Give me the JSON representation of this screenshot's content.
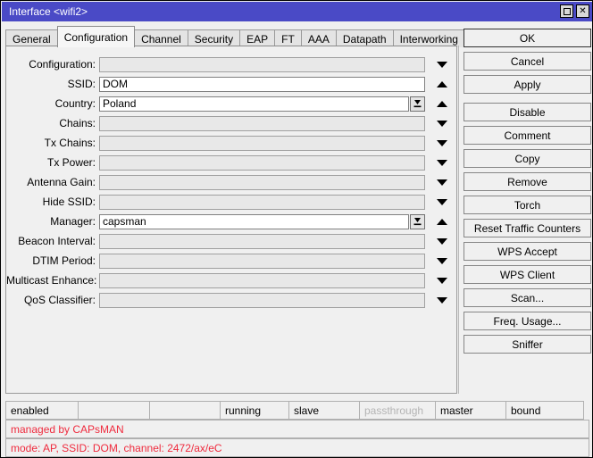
{
  "window": {
    "title": "Interface <wifi2>",
    "maximize_label": "maximize-box",
    "close_label": "✕"
  },
  "tabs": [
    {
      "label": "General",
      "active": false
    },
    {
      "label": "Configuration",
      "active": true
    },
    {
      "label": "Channel",
      "active": false
    },
    {
      "label": "Security",
      "active": false
    },
    {
      "label": "EAP",
      "active": false
    },
    {
      "label": "FT",
      "active": false
    },
    {
      "label": "AAA",
      "active": false
    },
    {
      "label": "Datapath",
      "active": false
    },
    {
      "label": "Interworking",
      "active": false
    },
    {
      "label": "...",
      "active": false
    }
  ],
  "form": {
    "fields": [
      {
        "label": "Configuration:",
        "value": "",
        "enabled": false,
        "arrow": "down",
        "picker": false
      },
      {
        "label": "SSID:",
        "value": "DOM",
        "enabled": true,
        "arrow": "up",
        "picker": false
      },
      {
        "label": "Country:",
        "value": "Poland",
        "enabled": true,
        "arrow": "up",
        "picker": true
      },
      {
        "label": "Chains:",
        "value": "",
        "enabled": false,
        "arrow": "down",
        "picker": false
      },
      {
        "label": "Tx Chains:",
        "value": "",
        "enabled": false,
        "arrow": "down",
        "picker": false
      },
      {
        "label": "Tx Power:",
        "value": "",
        "enabled": false,
        "arrow": "down",
        "picker": false
      },
      {
        "label": "Antenna Gain:",
        "value": "",
        "enabled": false,
        "arrow": "down",
        "picker": false
      },
      {
        "label": "Hide SSID:",
        "value": "",
        "enabled": false,
        "arrow": "down",
        "picker": false
      },
      {
        "label": "Manager:",
        "value": "capsman",
        "enabled": true,
        "arrow": "up",
        "picker": true
      },
      {
        "label": "Beacon Interval:",
        "value": "",
        "enabled": false,
        "arrow": "down",
        "picker": false
      },
      {
        "label": "DTIM Period:",
        "value": "",
        "enabled": false,
        "arrow": "down",
        "picker": false
      },
      {
        "label": "Multicast Enhance:",
        "value": "",
        "enabled": false,
        "arrow": "down",
        "picker": false
      },
      {
        "label": "QoS Classifier:",
        "value": "",
        "enabled": false,
        "arrow": "down",
        "picker": false
      }
    ]
  },
  "buttons": [
    {
      "label": "OK",
      "primary": true,
      "gap": false
    },
    {
      "label": "Cancel",
      "primary": false,
      "gap": false
    },
    {
      "label": "Apply",
      "primary": false,
      "gap": true
    },
    {
      "label": "Disable",
      "primary": false,
      "gap": false
    },
    {
      "label": "Comment",
      "primary": false,
      "gap": false
    },
    {
      "label": "Copy",
      "primary": false,
      "gap": false
    },
    {
      "label": "Remove",
      "primary": false,
      "gap": false
    },
    {
      "label": "Torch",
      "primary": false,
      "gap": false
    },
    {
      "label": "Reset Traffic Counters",
      "primary": false,
      "gap": false
    },
    {
      "label": "WPS Accept",
      "primary": false,
      "gap": false
    },
    {
      "label": "WPS Client",
      "primary": false,
      "gap": false
    },
    {
      "label": "Scan...",
      "primary": false,
      "gap": false
    },
    {
      "label": "Freq. Usage...",
      "primary": false,
      "gap": false
    },
    {
      "label": "Sniffer",
      "primary": false,
      "gap": false
    }
  ],
  "status": {
    "cells": [
      {
        "text": "enabled",
        "width": 82,
        "dim": false
      },
      {
        "text": "",
        "width": 81,
        "dim": false
      },
      {
        "text": "",
        "width": 80,
        "dim": false
      },
      {
        "text": "running",
        "width": 78,
        "dim": false
      },
      {
        "text": "slave",
        "width": 80,
        "dim": false
      },
      {
        "text": "passthrough",
        "width": 86,
        "dim": true
      },
      {
        "text": "master",
        "width": 80,
        "dim": false
      },
      {
        "text": "bound",
        "width": 88,
        "dim": false
      }
    ],
    "line1": "managed by CAPsMAN",
    "line2": "mode: AP, SSID: DOM, channel: 2472/ax/eC"
  },
  "colors": {
    "titlebar": "#4a4ac6",
    "red_status": "#ef2b3e",
    "panel_bg": "#f0f0f0"
  }
}
